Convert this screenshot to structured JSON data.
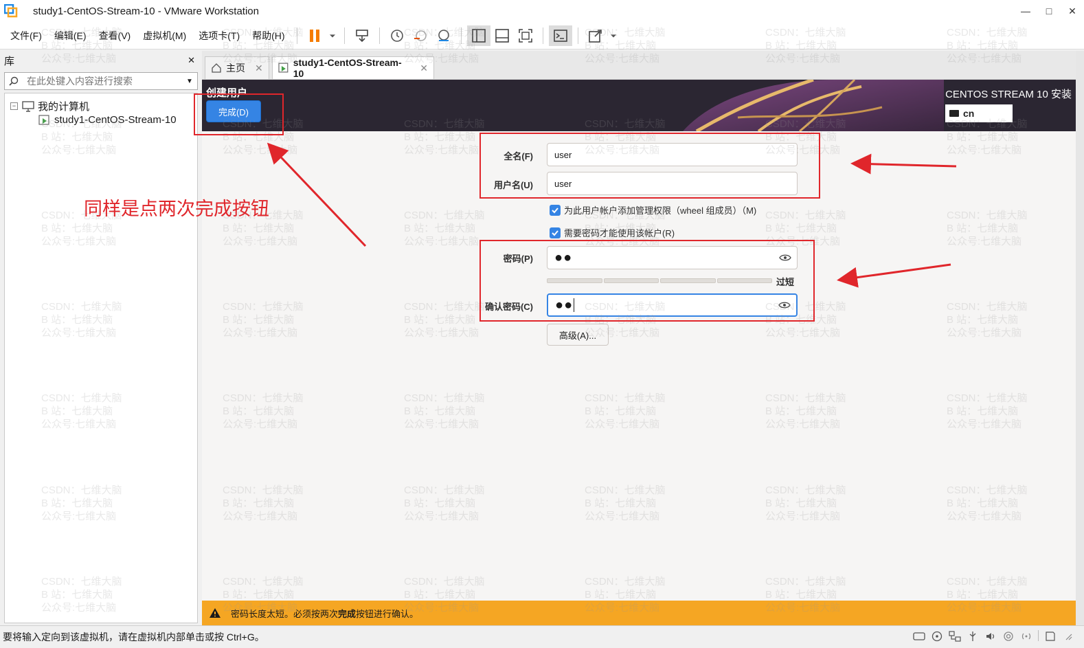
{
  "window": {
    "title": "study1-CentOS-Stream-10 - VMware Workstation",
    "controls": [
      "—",
      "□",
      "✕"
    ]
  },
  "menu": [
    "文件(F)",
    "编辑(E)",
    "查看(V)",
    "虚拟机(M)",
    "选项卡(T)",
    "帮助(H)"
  ],
  "library": {
    "title": "库",
    "close": "✕",
    "search_placeholder": "在此处键入内容进行搜索",
    "tree": {
      "root": "我的计算机",
      "toggle": "−",
      "child": "study1-CentOS-Stream-10"
    }
  },
  "tabs": [
    {
      "label": "主页",
      "close": "✕"
    },
    {
      "label": "study1-CentOS-Stream-10",
      "close": "✕"
    }
  ],
  "installer": {
    "section_title": "创建用户",
    "done_button": "完成(D)",
    "product": "CENTOS STREAM 10 安装",
    "keyboard_layout": "cn",
    "fullname_label": "全名(F)",
    "fullname_value": "user",
    "username_label": "用户名(U)",
    "username_value": "user",
    "admin_checkbox": "为此用户帐户添加管理权限（wheel 组成员）（M)",
    "require_password_checkbox": "需要密码才能使用该帐户(R)",
    "password_label": "密码(P)",
    "password_value": "●●",
    "strength_text": "过短",
    "confirm_label": "确认密码(C)",
    "confirm_value": "●●",
    "advanced_button": "高级(A)...",
    "warning_prefix": "密码长度太短。必须按两次",
    "warning_bold": "完成",
    "warning_suffix": "按钮进行确认。"
  },
  "annotation": {
    "text": "同样是点两次完成按钮",
    "color": "#e0262b"
  },
  "status": {
    "text": "要将输入定向到该虚拟机，请在虚拟机内部单击或按 Ctrl+G。"
  },
  "watermark": "CSDN：七维大脑\nB 站：七维大脑\n公众号:七维大脑",
  "colors": {
    "accent": "#3584e4",
    "warning": "#f5a623",
    "header_bg": "#2b2632"
  }
}
